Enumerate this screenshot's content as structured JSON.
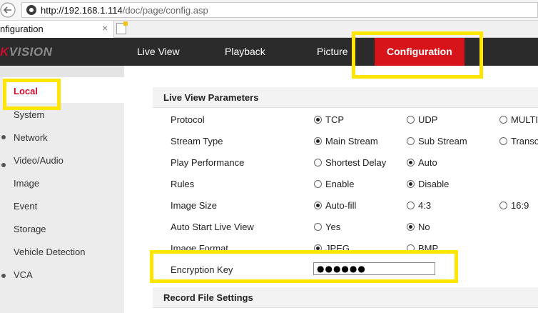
{
  "browser": {
    "url_host": "http://192.168.1.114",
    "url_path": "/doc/page/config.asp",
    "tab_title": "nfiguration",
    "tab_close": "×"
  },
  "header": {
    "logo_k": "K",
    "logo_rest": "VISION",
    "nav": [
      "Live View",
      "Playback",
      "Picture",
      "Configuration"
    ]
  },
  "sidebar": {
    "items": [
      "Local",
      "System",
      "Network",
      "Video/Audio",
      "Image",
      "Event",
      "Storage",
      "Vehicle Detection",
      "VCA"
    ],
    "active": "Local"
  },
  "main": {
    "section1": "Live View Parameters",
    "section2": "Record File Settings",
    "rows": [
      {
        "label": "Protocol",
        "options": [
          "TCP",
          "UDP",
          "MULTIC"
        ],
        "selected": 0
      },
      {
        "label": "Stream Type",
        "options": [
          "Main Stream",
          "Sub Stream",
          "Transco"
        ],
        "selected": 0
      },
      {
        "label": "Play Performance",
        "options": [
          "Shortest Delay",
          "Auto"
        ],
        "selected": 1
      },
      {
        "label": "Rules",
        "options": [
          "Enable",
          "Disable"
        ],
        "selected": 1
      },
      {
        "label": "Image Size",
        "options": [
          "Auto-fill",
          "4:3",
          "16:9"
        ],
        "selected": 0
      },
      {
        "label": "Auto Start Live View",
        "options": [
          "Yes",
          "No"
        ],
        "selected": 1
      },
      {
        "label": "Image Format",
        "options": [
          "JPEG",
          "BMP"
        ],
        "selected": 0
      }
    ],
    "encryption_label": "Encryption Key",
    "encryption_value": "●●●●●●"
  },
  "colors": {
    "accent_red": "#d7141a",
    "highlight_yellow": "#ffe600",
    "header_bg": "#2b2b2b"
  }
}
